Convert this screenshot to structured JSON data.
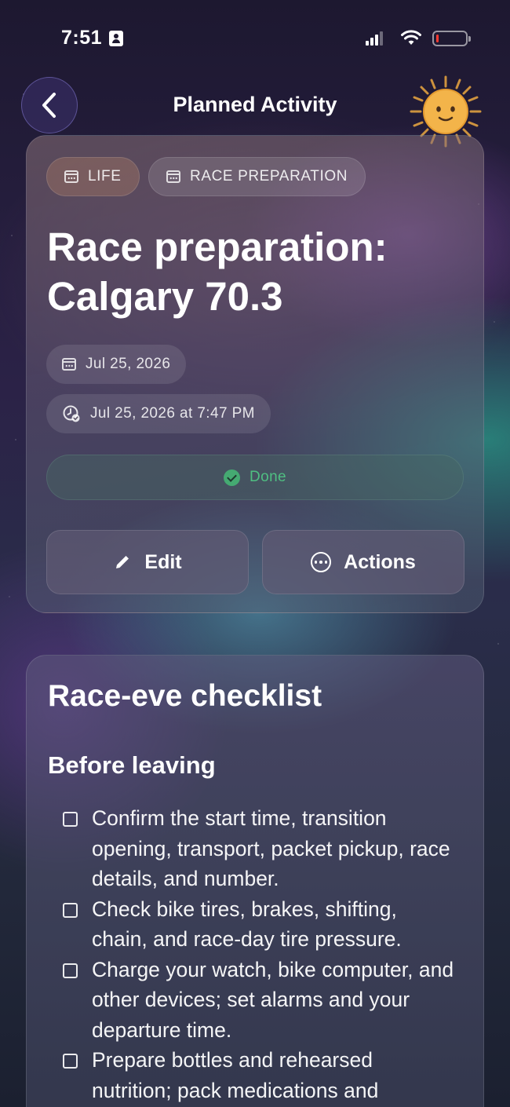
{
  "status_bar": {
    "time": "7:51",
    "battery_level": 0.08,
    "battery_color": "#ff3b30"
  },
  "header": {
    "title": "Planned Activity",
    "back_icon": "chevron-left-icon",
    "avatar_icon": "sun-face-icon"
  },
  "activity": {
    "tags": [
      {
        "label": "LIFE",
        "icon": "calendar-icon"
      },
      {
        "label": "RACE PREPARATION",
        "icon": "calendar-icon"
      }
    ],
    "title": "Race preparation: Calgary 70.3",
    "date": "Jul 25, 2026",
    "datetime": "Jul 25, 2026 at 7:47 PM",
    "status": "Done",
    "status_color": "#4fbf82",
    "edit_label": "Edit",
    "actions_label": "Actions"
  },
  "checklist": {
    "title": "Race-eve checklist",
    "section": "Before leaving",
    "items": [
      "Confirm the start time, transition opening, transport, packet pickup, race details, and number.",
      "Check bike tires, brakes, shifting, chain, and race-day tire pressure.",
      "Charge your watch, bike computer, and other devices; set alarms and your departure time.",
      "Prepare bottles and rehearsed nutrition; pack medications and personal care essentials."
    ]
  }
}
